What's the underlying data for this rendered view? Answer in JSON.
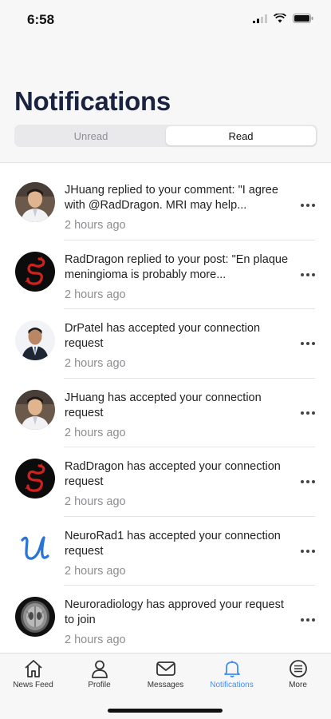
{
  "status": {
    "time": "6:58"
  },
  "header": {
    "title": "Notifications"
  },
  "segments": {
    "unread": "Unread",
    "read": "Read"
  },
  "notifications": [
    {
      "avatar": "jhuang-photo",
      "message": "JHuang replied to your comment: \"I agree with @RadDragon. MRI may help...",
      "time": "2 hours ago"
    },
    {
      "avatar": "raddragon-logo",
      "message": "RadDragon replied to your post: \"En plaque meningioma is probably more...",
      "time": "2 hours ago"
    },
    {
      "avatar": "drpatel-photo",
      "message": "DrPatel has accepted your connection request",
      "time": "2 hours ago"
    },
    {
      "avatar": "jhuang-photo",
      "message": "JHuang has accepted your connection request",
      "time": "2 hours ago"
    },
    {
      "avatar": "raddragon-logo",
      "message": "RadDragon has accepted your connection request",
      "time": "2 hours ago"
    },
    {
      "avatar": "neurorad1-logo",
      "message": "NeuroRad1 has accepted your connection request",
      "time": "2 hours ago"
    },
    {
      "avatar": "neuroradiology-scan",
      "message": "Neuroradiology has approved your request to join",
      "time": "2 hours ago"
    }
  ],
  "tabbar": [
    {
      "label": "News Feed",
      "icon": "home-icon"
    },
    {
      "label": "Profile",
      "icon": "person-icon"
    },
    {
      "label": "Messages",
      "icon": "envelope-icon"
    },
    {
      "label": "Notifications",
      "icon": "bell-icon"
    },
    {
      "label": "More",
      "icon": "menu-icon"
    }
  ],
  "colors": {
    "accent": "#3d8ef7",
    "title": "#1a2340"
  }
}
